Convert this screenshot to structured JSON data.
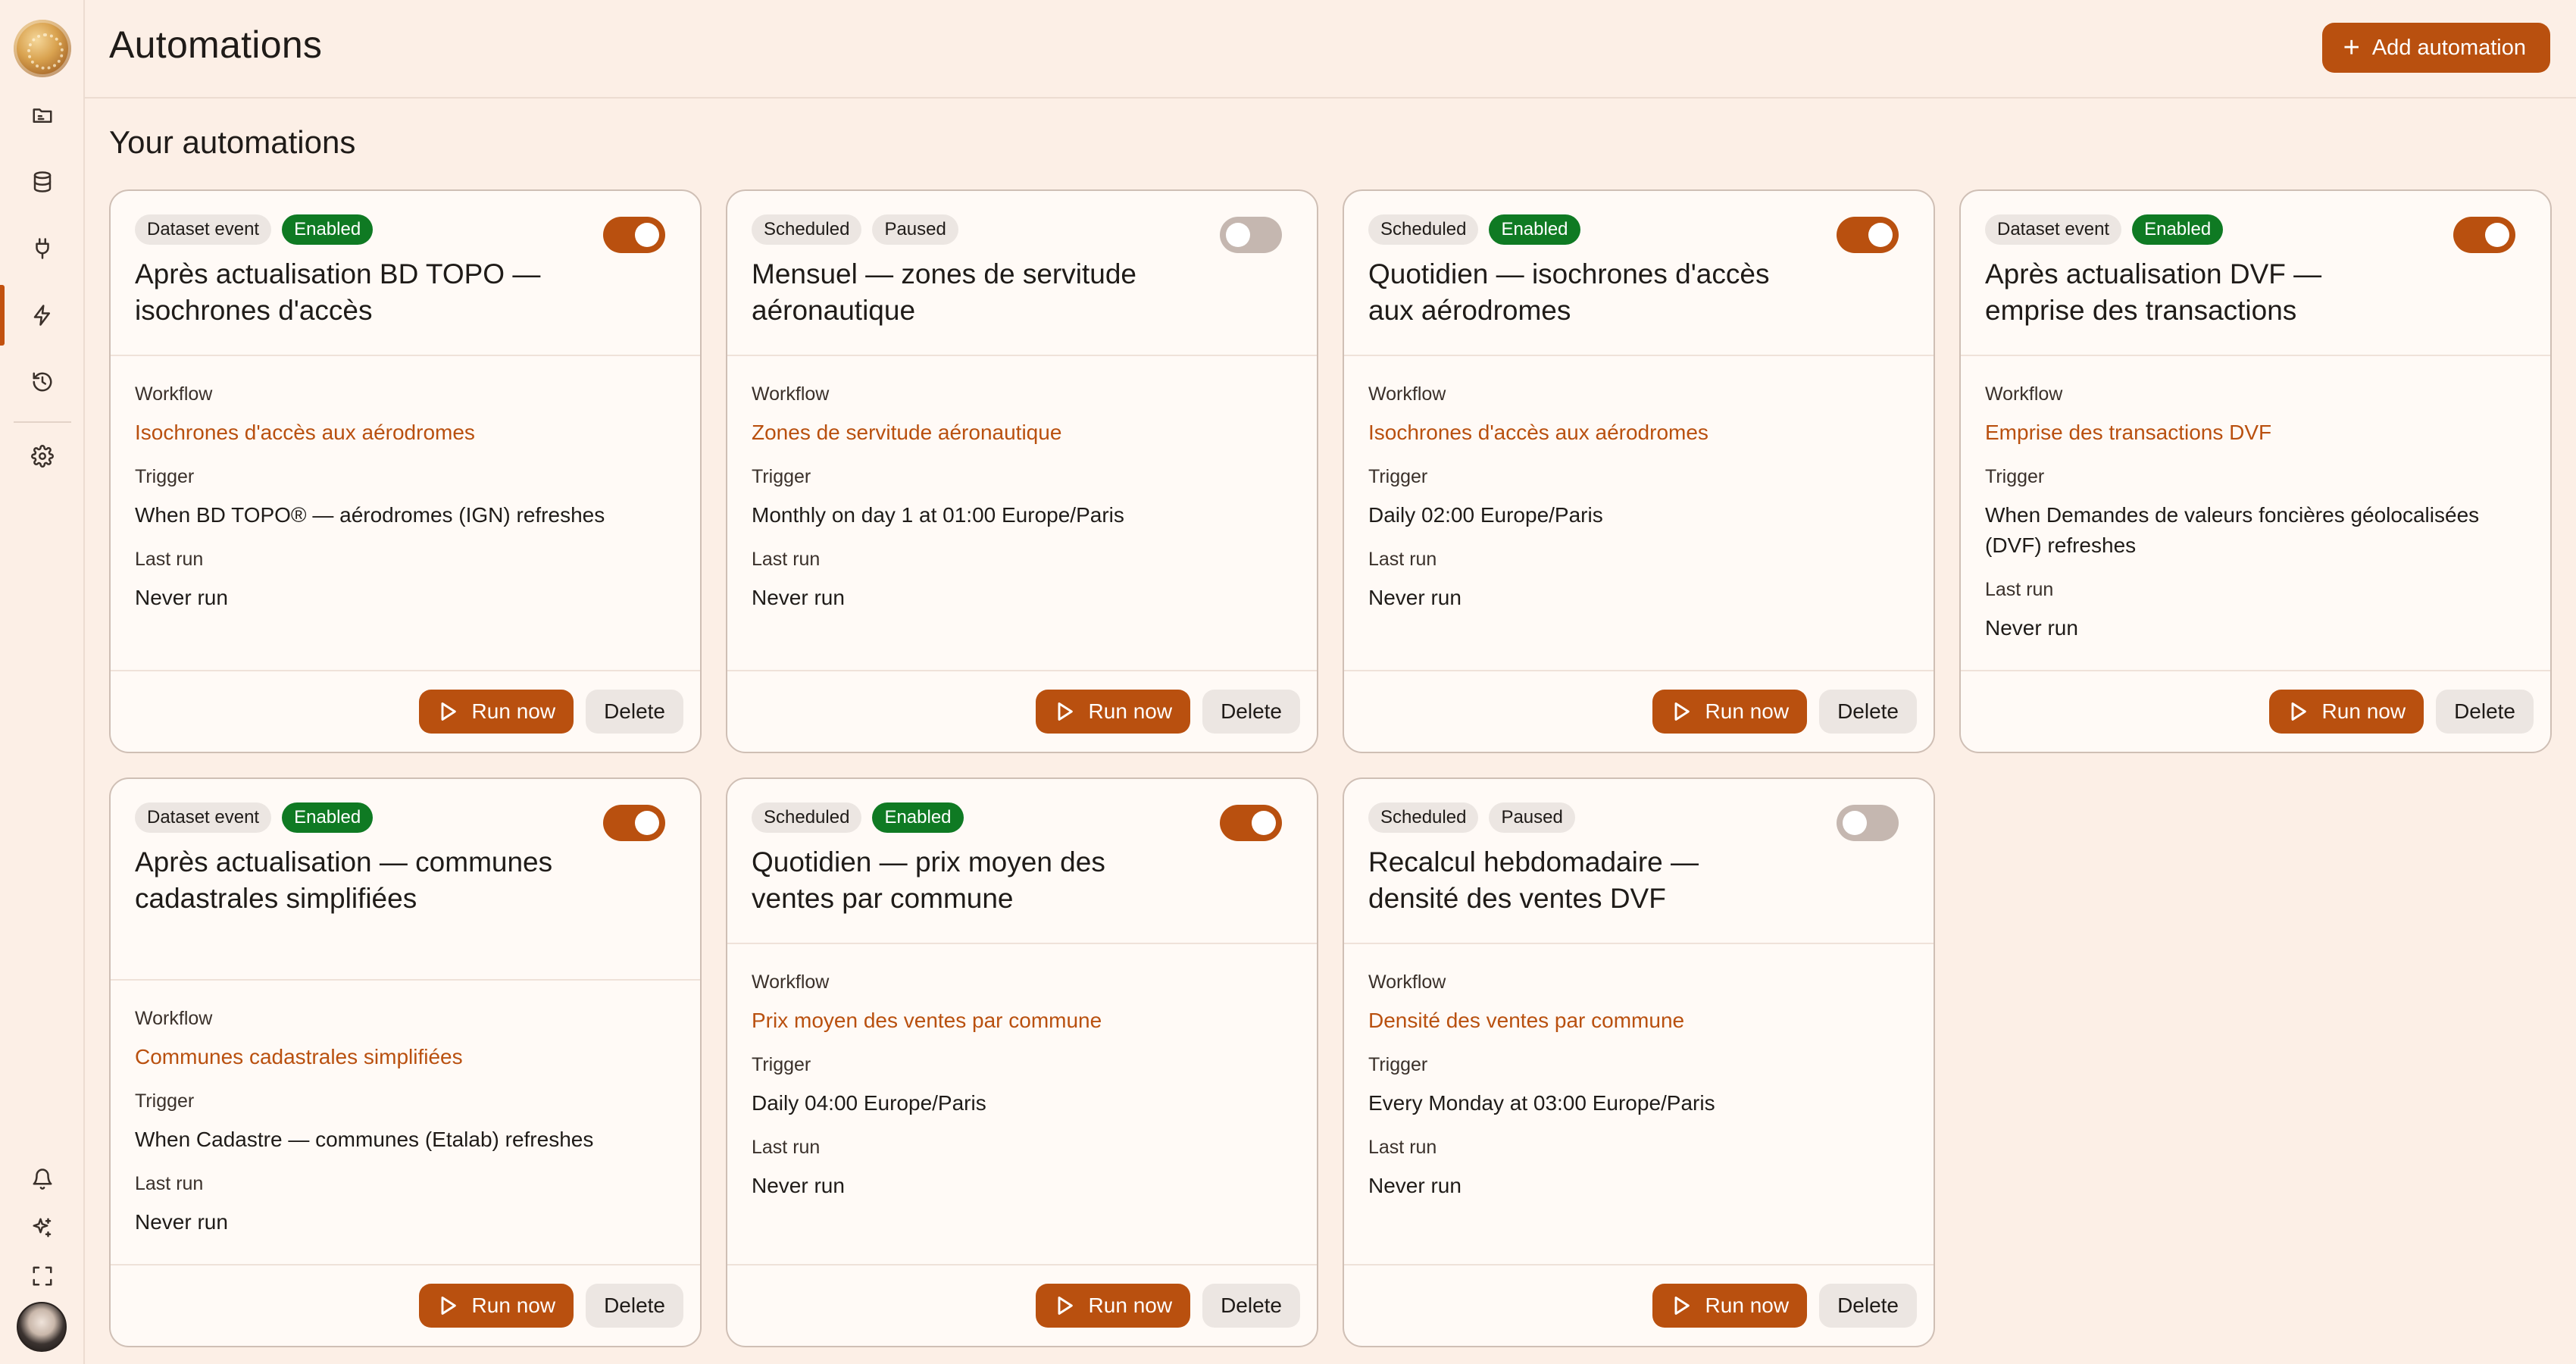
{
  "header": {
    "title": "Automations",
    "add_label": "Add automation",
    "section_title": "Your automations"
  },
  "sidebar": {
    "items": [
      {
        "icon": "folder-icon"
      },
      {
        "icon": "database-icon"
      },
      {
        "icon": "plug-icon"
      },
      {
        "icon": "lightning-icon",
        "active": true
      },
      {
        "icon": "history-icon"
      },
      {
        "icon": "gear-icon"
      },
      {
        "icon": "bell-icon"
      },
      {
        "icon": "sparkles-icon"
      },
      {
        "icon": "fullscreen-icon"
      }
    ]
  },
  "labels": {
    "workflow": "Workflow",
    "trigger": "Trigger",
    "last_run": "Last run",
    "run_now": "Run now",
    "delete": "Delete"
  },
  "colors": {
    "accent": "#b9500f",
    "enabled_badge": "#0f7a23",
    "background": "#fcefe6"
  },
  "cards": [
    {
      "type": "Dataset event",
      "status": "Enabled",
      "enabled": true,
      "title": "Après actualisation BD TOPO — isochrones d'accès",
      "workflow": "Isochrones d'accès aux aérodromes",
      "trigger": "When BD TOPO® — aérodromes (IGN) refreshes",
      "last_run": "Never run"
    },
    {
      "type": "Scheduled",
      "status": "Paused",
      "enabled": false,
      "title": "Mensuel — zones de servitude aéronautique",
      "workflow": "Zones de servitude aéronautique",
      "trigger": "Monthly on day 1 at 01:00 Europe/Paris",
      "last_run": "Never run"
    },
    {
      "type": "Scheduled",
      "status": "Enabled",
      "enabled": true,
      "title": "Quotidien — isochrones d'accès aux aérodromes",
      "workflow": "Isochrones d'accès aux aérodromes",
      "trigger": "Daily 02:00 Europe/Paris",
      "last_run": "Never run"
    },
    {
      "type": "Dataset event",
      "status": "Enabled",
      "enabled": true,
      "title": "Après actualisation DVF — emprise des transactions",
      "workflow": "Emprise des transactions DVF",
      "trigger": "When Demandes de valeurs foncières géolocalisées (DVF) refreshes",
      "last_run": "Never run"
    },
    {
      "type": "Dataset event",
      "status": "Enabled",
      "enabled": true,
      "title": "Après actualisation — communes cadastrales simplifiées",
      "workflow": "Communes cadastrales simplifiées",
      "trigger": "When Cadastre — communes (Etalab) refreshes",
      "last_run": "Never run"
    },
    {
      "type": "Scheduled",
      "status": "Enabled",
      "enabled": true,
      "title": "Quotidien — prix moyen des ventes par commune",
      "workflow": "Prix moyen des ventes par commune",
      "trigger": "Daily 04:00 Europe/Paris",
      "last_run": "Never run"
    },
    {
      "type": "Scheduled",
      "status": "Paused",
      "enabled": false,
      "title": "Recalcul hebdomadaire — densité des ventes DVF",
      "workflow": "Densité des ventes par commune",
      "trigger": "Every Monday at 03:00 Europe/Paris",
      "last_run": "Never run"
    }
  ]
}
